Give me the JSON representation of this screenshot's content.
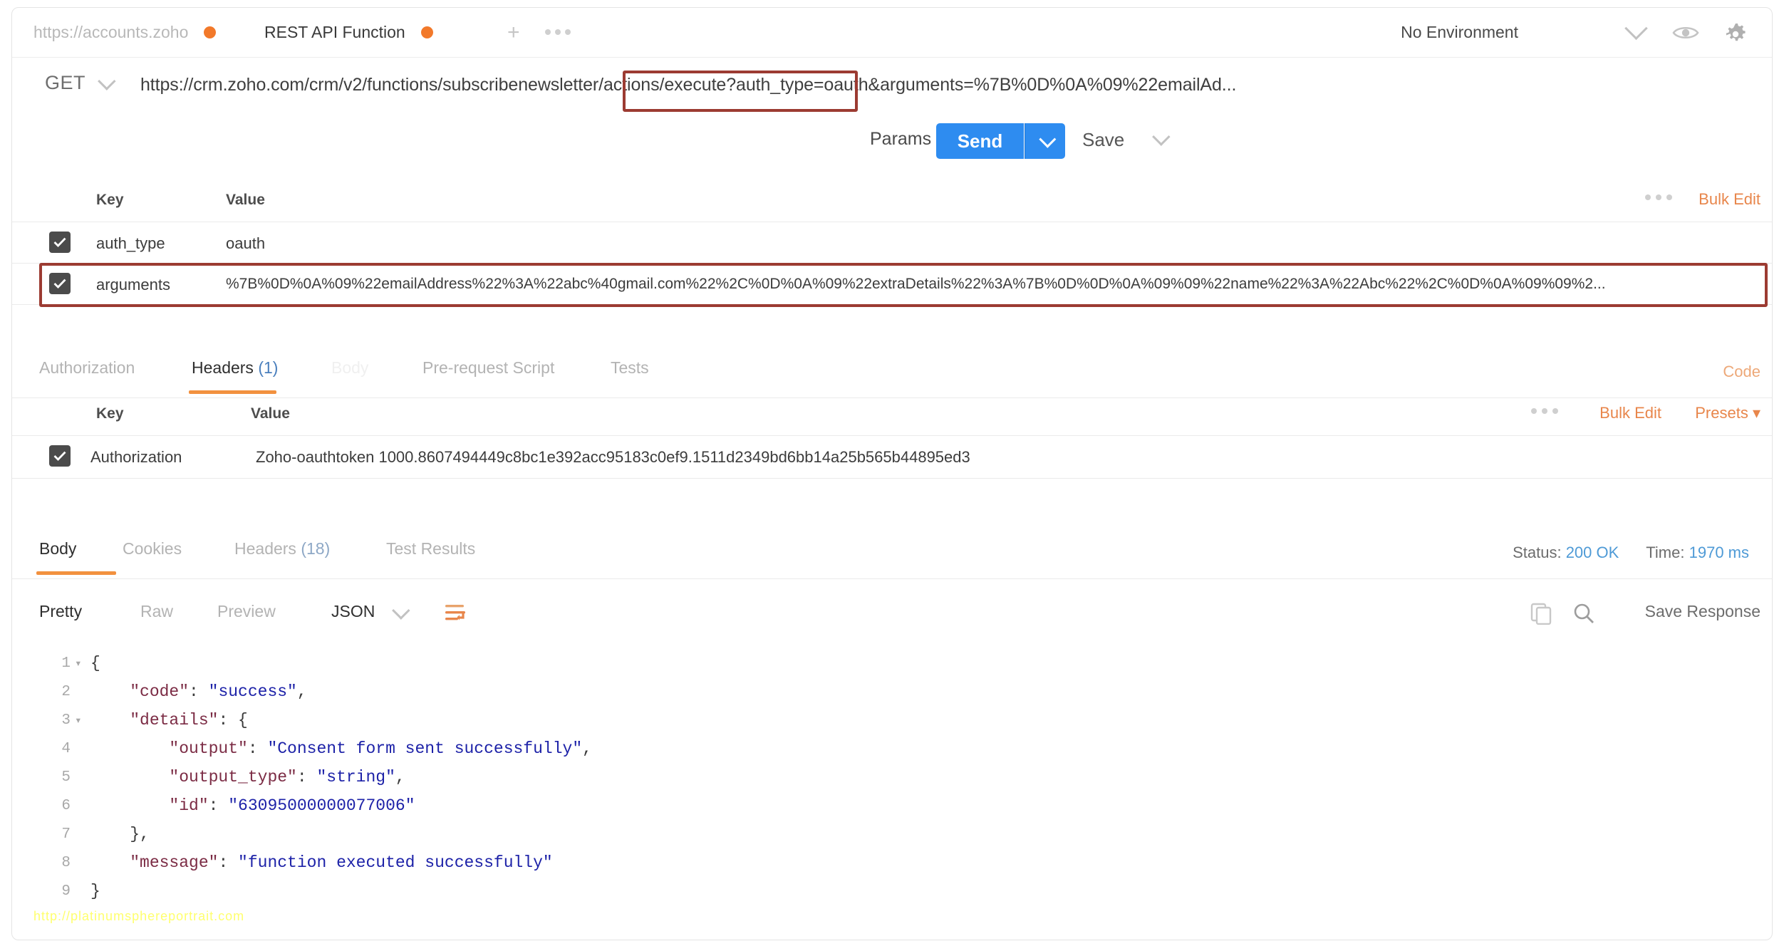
{
  "window": {
    "tabs": [
      {
        "label": "https://accounts.zoho",
        "unsaved": true,
        "active": false
      },
      {
        "label": "REST API Function",
        "unsaved": true,
        "active": true
      }
    ],
    "new_tab_label": "+",
    "environment": "No Environment"
  },
  "request": {
    "method": "GET",
    "url": "https://crm.zoho.com/crm/v2/functions/subscribenewsletter/actions/execute?auth_type=oauth&arguments=%7B%0D%0A%09%22emailAd...",
    "params_label": "Params",
    "send_label": "Send",
    "save_label": "Save",
    "params_table": {
      "columns": [
        "Key",
        "Value"
      ],
      "bulk_edit_label": "Bulk Edit",
      "rows": [
        {
          "checked": true,
          "key": "auth_type",
          "value": "oauth"
        },
        {
          "checked": true,
          "key": "arguments",
          "value": "%7B%0D%0A%09%22emailAddress%22%3A%22abc%40gmail.com%22%2C%0D%0A%09%22extraDetails%22%3A%7B%0D%0D%0A%09%09%22name%22%3A%22Abc%22%2C%0D%0A%09%09%2..."
        }
      ]
    },
    "tabs": [
      {
        "label": "Authorization",
        "active": false
      },
      {
        "label": "Headers",
        "count": "(1)",
        "active": true
      },
      {
        "label": "Body",
        "active": false
      },
      {
        "label": "Pre-request Script",
        "active": false
      },
      {
        "label": "Tests",
        "active": false
      }
    ],
    "code_label": "Code",
    "headers_table": {
      "columns": [
        "Key",
        "Value"
      ],
      "bulk_edit_label": "Bulk Edit",
      "presets_label": "Presets",
      "rows": [
        {
          "checked": true,
          "key": "Authorization",
          "value": "Zoho-oauthtoken 1000.8607494449c8bc1e392acc95183c0ef9.1511d2349bd6bb14a25b565b44895ed3"
        }
      ]
    }
  },
  "response": {
    "tabs": [
      {
        "label": "Body",
        "active": true
      },
      {
        "label": "Cookies",
        "active": false
      },
      {
        "label": "Headers",
        "count": "(18)",
        "active": false
      },
      {
        "label": "Test Results",
        "active": false
      }
    ],
    "status_label": "Status:",
    "status_value": "200 OK",
    "time_label": "Time:",
    "time_value": "1970 ms",
    "formats": [
      {
        "label": "Pretty",
        "active": true
      },
      {
        "label": "Raw",
        "active": false
      },
      {
        "label": "Preview",
        "active": false
      }
    ],
    "language": "JSON",
    "save_response_label": "Save Response",
    "body_lines": [
      {
        "n": "1",
        "fold": true,
        "segments": [
          {
            "t": "{",
            "c": "p"
          }
        ]
      },
      {
        "n": "2",
        "fold": false,
        "segments": [
          {
            "t": "    \"code\"",
            "c": "k"
          },
          {
            "t": ": ",
            "c": "p"
          },
          {
            "t": "\"success\"",
            "c": "s"
          },
          {
            "t": ",",
            "c": "p"
          }
        ]
      },
      {
        "n": "3",
        "fold": true,
        "segments": [
          {
            "t": "    \"details\"",
            "c": "k"
          },
          {
            "t": ": {",
            "c": "p"
          }
        ]
      },
      {
        "n": "4",
        "fold": false,
        "segments": [
          {
            "t": "        \"output\"",
            "c": "k"
          },
          {
            "t": ": ",
            "c": "p"
          },
          {
            "t": "\"Consent form sent successfully\"",
            "c": "s"
          },
          {
            "t": ",",
            "c": "p"
          }
        ]
      },
      {
        "n": "5",
        "fold": false,
        "segments": [
          {
            "t": "        \"output_type\"",
            "c": "k"
          },
          {
            "t": ": ",
            "c": "p"
          },
          {
            "t": "\"string\"",
            "c": "s"
          },
          {
            "t": ",",
            "c": "p"
          }
        ]
      },
      {
        "n": "6",
        "fold": false,
        "segments": [
          {
            "t": "        \"id\"",
            "c": "k"
          },
          {
            "t": ": ",
            "c": "p"
          },
          {
            "t": "\"63095000000077006\"",
            "c": "s"
          }
        ]
      },
      {
        "n": "7",
        "fold": false,
        "segments": [
          {
            "t": "    },",
            "c": "p"
          }
        ]
      },
      {
        "n": "8",
        "fold": false,
        "segments": [
          {
            "t": "    \"message\"",
            "c": "k"
          },
          {
            "t": ": ",
            "c": "p"
          },
          {
            "t": "\"function executed successfully\"",
            "c": "s"
          }
        ]
      },
      {
        "n": "9",
        "fold": false,
        "segments": [
          {
            "t": "}",
            "c": "p"
          }
        ]
      }
    ]
  },
  "watermark": "http://platinumsphereportrait.com"
}
